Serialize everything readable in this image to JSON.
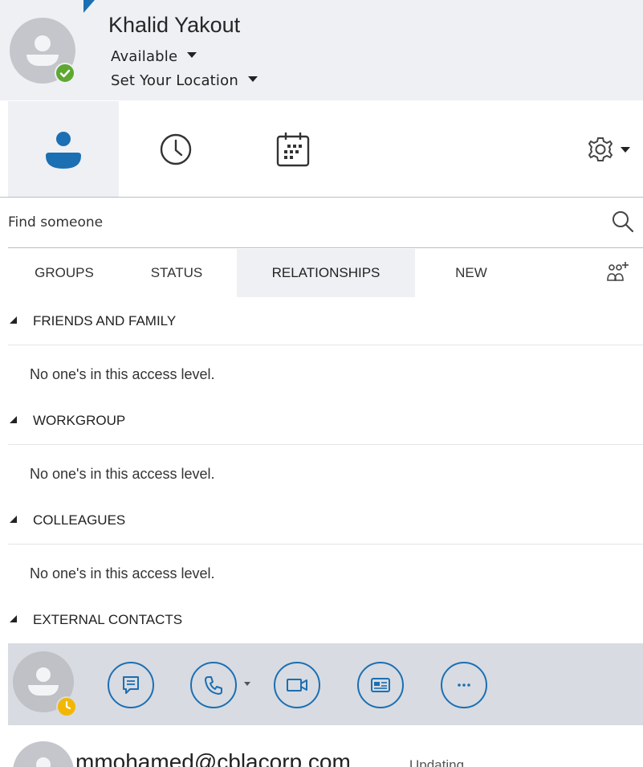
{
  "profile": {
    "name": "Khalid Yakout",
    "availability": "Available",
    "location": "Set Your Location",
    "presence": "available"
  },
  "nav": {
    "tabs": [
      {
        "name": "contacts",
        "icon": "person-icon",
        "active": true
      },
      {
        "name": "conversations",
        "icon": "clock-icon",
        "active": false
      },
      {
        "name": "meetings",
        "icon": "calendar-icon",
        "active": false
      }
    ],
    "options_icon": "gear-icon"
  },
  "search": {
    "placeholder": "Find someone"
  },
  "filters": {
    "tabs": [
      "GROUPS",
      "STATUS",
      "RELATIONSHIPS",
      "NEW"
    ],
    "active": "RELATIONSHIPS",
    "add_contact_icon": "add-contact-icon"
  },
  "groups": [
    {
      "label": "FRIENDS AND FAMILY",
      "note": "No one's in this access level."
    },
    {
      "label": "WORKGROUP",
      "note": "No one's in this access level."
    },
    {
      "label": "COLLEAGUES",
      "note": "No one's in this access level."
    },
    {
      "label": "EXTERNAL CONTACTS",
      "note": ""
    }
  ],
  "action_bar": {
    "buttons": [
      "im-icon",
      "phone-icon",
      "video-icon",
      "contact-card-icon",
      "more-icon"
    ],
    "presence": "away"
  },
  "contact": {
    "name": "mmohamed@cblacorp.com",
    "status": "Updating..."
  },
  "colors": {
    "accent": "#1b6fb3",
    "available": "#5ea831",
    "away": "#f2b705",
    "header_bg": "#eef0f4",
    "action_bar_bg": "#d8dbe1"
  }
}
